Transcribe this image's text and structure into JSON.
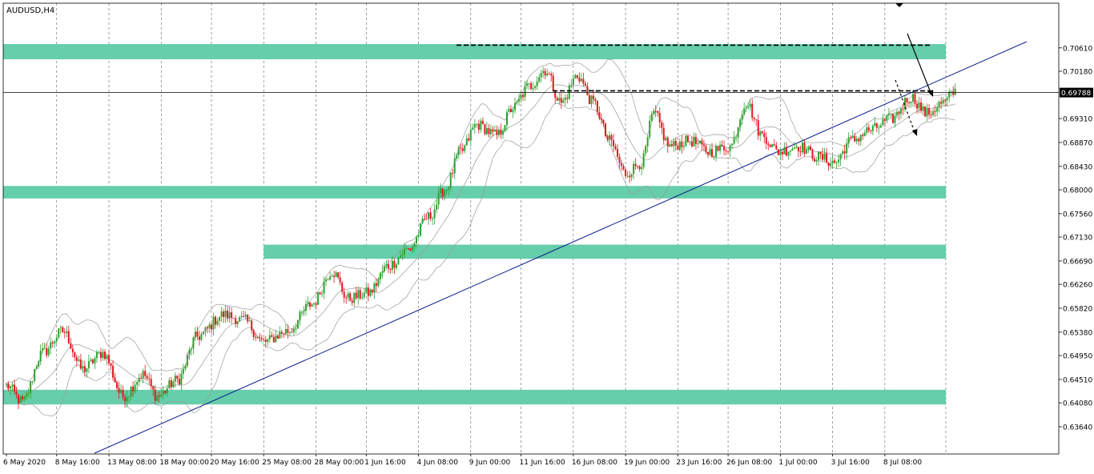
{
  "window": {
    "title": "AUDUSD,H4"
  },
  "colors": {
    "background": "#ffffff",
    "zone": "#66ceaa",
    "bull": "#2ea02e",
    "bear": "#e2161e",
    "trendline": "#0a1a8c",
    "bands": "#9a9a9a",
    "grid": "#606060",
    "price_label_bg": "#000000",
    "price_label_text": "#ffffff"
  },
  "chart_data": {
    "type": "candlestick",
    "title": "AUDUSD,H4",
    "symbol": "AUDUSD",
    "timeframe": "H4",
    "ylim": [
      0.6364,
      0.7099
    ],
    "y_ticks": [
      "0.70610",
      "0.70180",
      "0.69310",
      "0.68870",
      "0.68430",
      "0.68000",
      "0.67560",
      "0.67130",
      "0.66690",
      "0.66260",
      "0.65820",
      "0.65380",
      "0.64950",
      "0.64510",
      "0.64080",
      "0.63640"
    ],
    "x_ticks": [
      "6 May 2020",
      "8 May 16:00",
      "13 May 08:00",
      "18 May 00:00",
      "20 May 16:00",
      "25 May 08:00",
      "28 May 00:00",
      "1 Jun 16:00",
      "4 Jun 08:00",
      "9 Jun 00:00",
      "11 Jun 16:00",
      "16 Jun 08:00",
      "19 Jun 00:00",
      "23 Jun 16:00",
      "26 Jun 08:00",
      "1 Jul 00:00",
      "3 Jul 16:00",
      "8 Jul 08:00"
    ],
    "current_price": "0.69788",
    "grid": true,
    "indicators": [
      "bollinger-bands"
    ],
    "keyframes": [
      [
        0,
        0.644
      ],
      [
        8,
        0.641
      ],
      [
        18,
        0.65
      ],
      [
        28,
        0.654
      ],
      [
        38,
        0.647
      ],
      [
        48,
        0.65
      ],
      [
        58,
        0.642
      ],
      [
        68,
        0.646
      ],
      [
        75,
        0.642
      ],
      [
        85,
        0.645
      ],
      [
        95,
        0.653
      ],
      [
        108,
        0.657
      ],
      [
        118,
        0.656
      ],
      [
        128,
        0.652
      ],
      [
        140,
        0.654
      ],
      [
        152,
        0.659
      ],
      [
        162,
        0.665
      ],
      [
        170,
        0.66
      ],
      [
        180,
        0.661
      ],
      [
        190,
        0.666
      ],
      [
        200,
        0.669
      ],
      [
        210,
        0.675
      ],
      [
        218,
        0.68
      ],
      [
        226,
        0.687
      ],
      [
        234,
        0.692
      ],
      [
        244,
        0.69
      ],
      [
        252,
        0.695
      ],
      [
        260,
        0.699
      ],
      [
        268,
        0.702
      ],
      [
        276,
        0.696
      ],
      [
        284,
        0.701
      ],
      [
        292,
        0.696
      ],
      [
        300,
        0.689
      ],
      [
        308,
        0.683
      ],
      [
        316,
        0.685
      ],
      [
        322,
        0.694
      ],
      [
        330,
        0.688
      ],
      [
        340,
        0.689
      ],
      [
        350,
        0.687
      ],
      [
        360,
        0.688
      ],
      [
        368,
        0.696
      ],
      [
        376,
        0.69
      ],
      [
        384,
        0.687
      ],
      [
        394,
        0.688
      ],
      [
        404,
        0.686
      ],
      [
        412,
        0.685
      ],
      [
        420,
        0.689
      ],
      [
        430,
        0.691
      ],
      [
        440,
        0.693
      ],
      [
        450,
        0.697
      ],
      [
        458,
        0.694
      ],
      [
        466,
        0.696
      ],
      [
        472,
        0.698
      ]
    ],
    "zones": [
      {
        "from": 0.704,
        "to": 0.7068
      },
      {
        "from": 0.6784,
        "to": 0.6807
      },
      {
        "from": 0.6673,
        "to": 0.6699
      },
      {
        "from": 0.6405,
        "to": 0.6432
      }
    ],
    "dashed_levels": [
      {
        "price": 0.7066,
        "x_from": "4 Jun 08:00",
        "x_to_right": true
      },
      {
        "price": 0.6982,
        "x_from": "11 Jun 16:00",
        "x_to_right": true
      }
    ],
    "trendline": {
      "from": [
        "6 May 2020",
        0.6358
      ],
      "to": [
        "8 Jul 08:00",
        0.7037
      ]
    },
    "arrows": [
      {
        "style": "solid",
        "from": [
          0.7062,
          "right"
        ],
        "to": [
          0.6953,
          "right"
        ]
      },
      {
        "style": "dashed",
        "from": [
          0.6975,
          "right"
        ],
        "to": [
          0.689,
          "right"
        ]
      }
    ]
  }
}
